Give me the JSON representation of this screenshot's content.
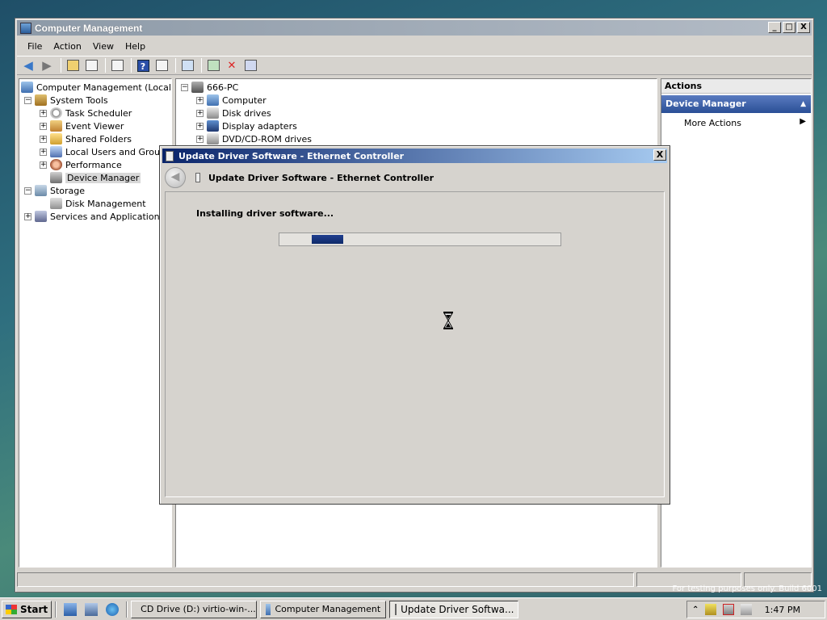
{
  "main_window": {
    "title": "Computer Management",
    "buttons": {
      "minimize": "_",
      "maximize": "□",
      "close": "X"
    }
  },
  "menubar": {
    "items": [
      "File",
      "Action",
      "View",
      "Help"
    ]
  },
  "left_tree": {
    "root": "Computer Management (Local)",
    "system_tools": "System Tools",
    "task_scheduler": "Task Scheduler",
    "event_viewer": "Event Viewer",
    "shared_folders": "Shared Folders",
    "local_users": "Local Users and Groups",
    "performance": "Performance",
    "device_manager": "Device Manager",
    "storage": "Storage",
    "disk_management": "Disk Management",
    "services": "Services and Applications"
  },
  "center_tree": {
    "root": "666-PC",
    "items": [
      "Computer",
      "Disk drives",
      "Display adapters",
      "DVD/CD-ROM drives"
    ]
  },
  "actions_pane": {
    "header": "Actions",
    "section": "Device Manager",
    "more_actions": "More Actions"
  },
  "dialog": {
    "title": "Update Driver Software - Ethernet Controller",
    "subtitle": "Update Driver Software - Ethernet Controller",
    "status": "Installing driver software...",
    "close": "X"
  },
  "taskbar": {
    "start": "Start",
    "tasks": [
      "CD Drive (D:) virtio-win-...",
      "Computer Management",
      "Update Driver Softwa..."
    ],
    "clock": "1:47 PM",
    "watermark": "For testing purposes only. Build 6001"
  }
}
